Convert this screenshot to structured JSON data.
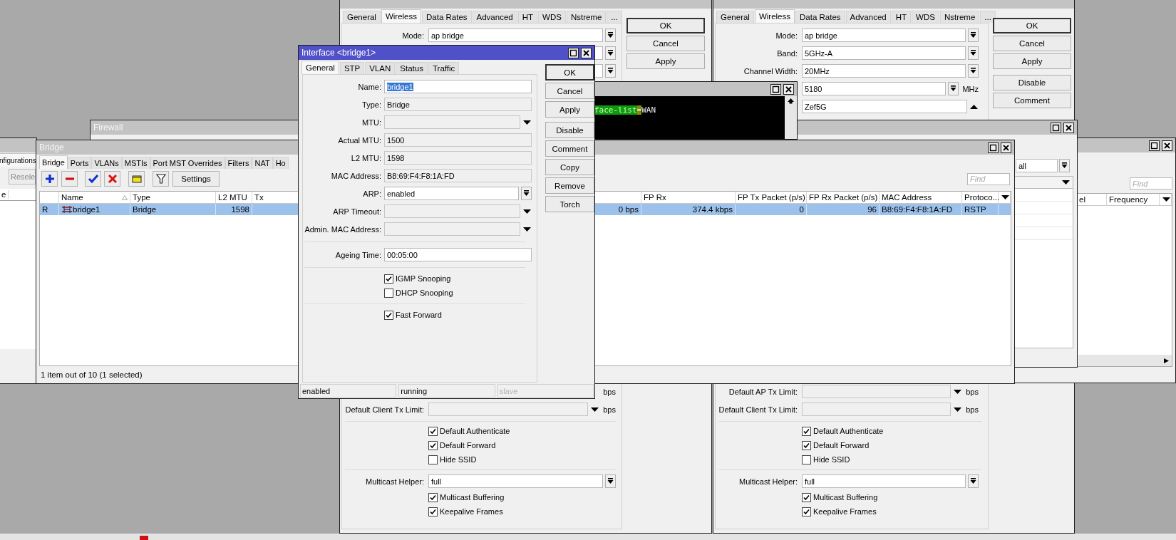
{
  "wireless_windows": [
    {
      "tabs": [
        {
          "label": "General",
          "selected": false
        },
        {
          "label": "Wireless",
          "selected": true
        },
        {
          "label": "Data Rates",
          "selected": false
        },
        {
          "label": "Advanced",
          "selected": false
        },
        {
          "label": "HT",
          "selected": false
        },
        {
          "label": "WDS",
          "selected": false
        },
        {
          "label": "Nstreme",
          "selected": false
        },
        {
          "label": "...",
          "selected": false
        }
      ],
      "top_rows": [
        {
          "kind": "select",
          "label": "Mode:",
          "value": "ap bridge"
        },
        {
          "kind": "select"
        },
        {
          "kind": "select"
        }
      ],
      "bottom_rows": [
        {
          "kind": "unit",
          "unit": "bps"
        },
        {
          "kind": "combo",
          "label": "Default Client Tx Limit:",
          "unit": "bps"
        },
        {
          "kind": "separator"
        },
        {
          "kind": "checkbox",
          "label": "Default Authenticate",
          "checked": true
        },
        {
          "kind": "checkbox",
          "label": "Default Forward",
          "checked": true
        },
        {
          "kind": "checkbox",
          "label": "Hide SSID",
          "checked": false
        },
        {
          "kind": "separator"
        },
        {
          "kind": "select",
          "label": "Multicast Helper:",
          "value": "full"
        },
        {
          "kind": "checkbox",
          "label": "Multicast Buffering",
          "checked": true
        },
        {
          "kind": "checkbox",
          "label": "Keepalive Frames",
          "checked": true
        }
      ],
      "buttons": [
        [
          {
            "label": "OK",
            "default": true
          },
          {
            "label": "Cancel",
            "default": false
          },
          {
            "label": "Apply",
            "default": false
          }
        ]
      ]
    },
    {
      "tabs": [
        {
          "label": "General",
          "selected": false
        },
        {
          "label": "Wireless",
          "selected": true
        },
        {
          "label": "Data Rates",
          "selected": false
        },
        {
          "label": "Advanced",
          "selected": false
        },
        {
          "label": "HT",
          "selected": false
        },
        {
          "label": "WDS",
          "selected": false
        },
        {
          "label": "Nstreme",
          "selected": false
        },
        {
          "label": "...",
          "selected": false
        }
      ],
      "top_rows": [
        {
          "kind": "select",
          "label": "Mode:",
          "value": "ap bridge"
        },
        {
          "kind": "select",
          "label": "Band:",
          "value": "5GHz-A"
        },
        {
          "kind": "select",
          "label": "Channel Width:",
          "value": "20MHz"
        },
        {
          "kind": "select",
          "value": "5180",
          "unit": "MHz"
        },
        {
          "kind": "expand",
          "value": "Zef5G"
        }
      ],
      "bottom_rows": [
        {
          "kind": "combo",
          "label": "Default AP Tx Limit:",
          "unit": "bps"
        },
        {
          "kind": "combo",
          "label": "Default Client Tx Limit:",
          "unit": "bps"
        },
        {
          "kind": "separator"
        },
        {
          "kind": "checkbox",
          "label": "Default Authenticate",
          "checked": true
        },
        {
          "kind": "checkbox",
          "label": "Default Forward",
          "checked": true
        },
        {
          "kind": "checkbox",
          "label": "Hide SSID",
          "checked": false
        },
        {
          "kind": "separator"
        },
        {
          "kind": "select",
          "label": "Multicast Helper:",
          "value": "full"
        },
        {
          "kind": "checkbox",
          "label": "Multicast Buffering",
          "checked": true
        },
        {
          "kind": "checkbox",
          "label": "Keepalive Frames",
          "checked": true
        }
      ],
      "buttons": [
        [
          {
            "label": "OK",
            "default": true
          },
          {
            "label": "Cancel",
            "default": false
          },
          {
            "label": "Apply",
            "default": false
          }
        ],
        [
          {
            "label": "Disable",
            "default": false
          },
          {
            "label": "Comment",
            "default": false
          }
        ]
      ]
    }
  ],
  "far_right_window": {
    "find_placeholder": "Find",
    "columns": [
      {
        "kind": "text",
        "label": "el"
      },
      {
        "kind": "text",
        "label": "Frequency"
      },
      {
        "kind": "menu"
      }
    ]
  },
  "filter_window": {
    "dropdown_value": "all"
  },
  "terminal": {
    "segments": [
      {
        "kind": "match",
        "text": "face-list"
      },
      {
        "kind": "operator",
        "text": "="
      },
      {
        "kind": "plain",
        "text": "WAN"
      }
    ]
  },
  "firewall_window": {
    "title": "Firewall"
  },
  "left_window": {
    "tab": "nfigurations",
    "button": "Resele",
    "column": "e"
  },
  "bridge_window": {
    "title": "Bridge",
    "tabs": [
      {
        "label": "Bridge",
        "selected": true
      },
      {
        "label": "Ports",
        "selected": false
      },
      {
        "label": "VLANs",
        "selected": false
      },
      {
        "label": "MSTIs",
        "selected": false
      },
      {
        "label": "Port MST Overrides",
        "selected": false
      },
      {
        "label": "Filters",
        "selected": false
      },
      {
        "label": "NAT",
        "selected": false
      },
      {
        "label": "Ho",
        "selected": false
      }
    ],
    "toolbar": [
      {
        "kind": "add"
      },
      {
        "kind": "remove"
      },
      {
        "kind": "enable"
      },
      {
        "kind": "disable"
      },
      {
        "kind": "comment"
      },
      {
        "kind": "filter"
      },
      {
        "kind": "button",
        "label": "Settings"
      }
    ],
    "find_placeholder": "Find",
    "columns": [
      {
        "kind": "text",
        "sorted": false
      },
      {
        "kind": "text",
        "label": "Name",
        "sorted": true
      },
      {
        "kind": "text",
        "label": "Type",
        "sorted": false
      },
      {
        "kind": "text",
        "label": "L2 MTU",
        "sorted": false
      },
      {
        "kind": "text",
        "label": "Tx",
        "sorted": false
      },
      {
        "kind": "text",
        "sorted": false
      },
      {
        "kind": "text",
        "label": "FP Rx",
        "sorted": false
      },
      {
        "kind": "text",
        "label": "FP Tx Packet (p/s)",
        "sorted": false
      },
      {
        "kind": "text",
        "label": "FP Rx Packet (p/s)",
        "sorted": false
      },
      {
        "kind": "text",
        "label": "MAC Address",
        "sorted": false
      },
      {
        "kind": "text",
        "label": "Protoco...",
        "sorted": false
      },
      {
        "kind": "menu",
        "sorted": false
      }
    ],
    "rows": [
      {
        "selected": true,
        "cells": [
          "R",
          "bridge1",
          "Bridge",
          "1598",
          null,
          "0 bps",
          "374.4 kbps",
          "0",
          "96",
          "B8:69:F4:F8:1A:FD",
          "RSTP"
        ]
      }
    ],
    "status": "1 item out of 10 (1 selected)"
  },
  "dialog": {
    "title": "Interface <bridge1>",
    "tabs": [
      {
        "label": "General",
        "selected": true
      },
      {
        "label": "STP",
        "selected": false
      },
      {
        "label": "VLAN",
        "selected": false
      },
      {
        "label": "Status",
        "selected": false
      },
      {
        "label": "Traffic",
        "selected": false
      }
    ],
    "rows": [
      {
        "kind": "text",
        "label": "Name:",
        "value": "bridge1",
        "text_selected": true
      },
      {
        "kind": "readonly",
        "label": "Type:",
        "value": "Bridge"
      },
      {
        "kind": "combo",
        "label": "MTU:"
      },
      {
        "kind": "readonly",
        "label": "Actual MTU:",
        "value": "1500"
      },
      {
        "kind": "readonly",
        "label": "L2 MTU:",
        "value": "1598"
      },
      {
        "kind": "readonly",
        "label": "MAC Address:",
        "value": "B8:69:F4:F8:1A:FD"
      },
      {
        "kind": "select",
        "label": "ARP:",
        "value": "enabled"
      },
      {
        "kind": "combo",
        "label": "ARP Timeout:"
      },
      {
        "kind": "combo",
        "label": "Admin. MAC Address:"
      },
      {
        "kind": "separator"
      },
      {
        "kind": "text",
        "label": "Ageing Time:",
        "value": "00:05:00",
        "text_selected": false
      },
      {
        "kind": "separator"
      },
      {
        "kind": "checkbox",
        "label": "IGMP Snooping",
        "checked": true
      },
      {
        "kind": "checkbox",
        "label": "DHCP Snooping",
        "checked": false
      },
      {
        "kind": "separator"
      },
      {
        "kind": "checkbox",
        "label": "Fast Forward",
        "checked": true
      }
    ],
    "buttons": [
      [
        {
          "label": "OK",
          "default": true
        },
        {
          "label": "Cancel",
          "default": false
        },
        {
          "label": "Apply",
          "default": false
        }
      ],
      [
        {
          "label": "Disable",
          "default": false
        },
        {
          "label": "Comment",
          "default": false
        },
        {
          "label": "Copy",
          "default": false
        },
        {
          "label": "Remove",
          "default": false
        },
        {
          "label": "Torch",
          "default": false
        }
      ]
    ],
    "status": [
      {
        "text": "enabled",
        "disabled": false
      },
      {
        "text": "running",
        "disabled": false
      },
      {
        "text": "slave",
        "disabled": true
      }
    ]
  }
}
